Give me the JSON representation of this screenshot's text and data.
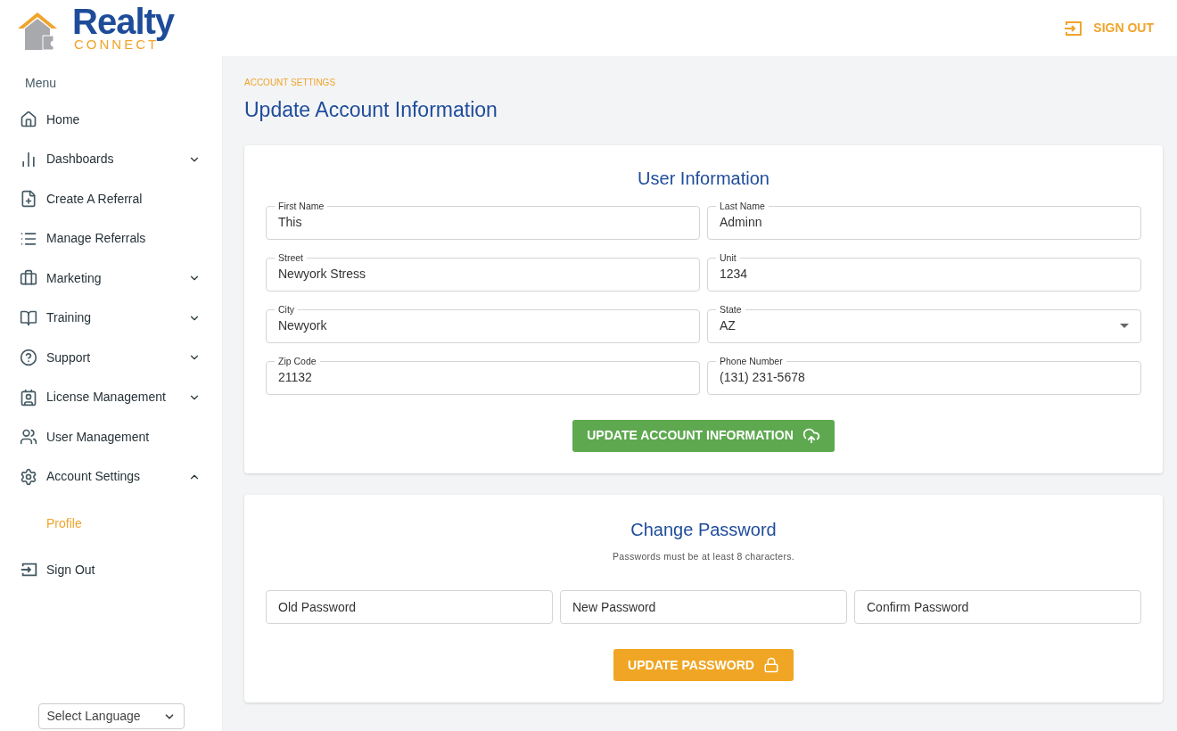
{
  "logo": {
    "word": "Realty",
    "tagline": "CONNECT"
  },
  "header": {
    "sign_out": "SIGN OUT"
  },
  "sidebar": {
    "heading": "Menu",
    "items": [
      {
        "label": "Home",
        "kind": "link"
      },
      {
        "label": "Dashboards",
        "kind": "group",
        "expanded": false
      },
      {
        "label": "Create A Referral",
        "kind": "link"
      },
      {
        "label": "Manage Referrals",
        "kind": "link"
      },
      {
        "label": "Marketing",
        "kind": "group",
        "expanded": false
      },
      {
        "label": "Training",
        "kind": "group",
        "expanded": false
      },
      {
        "label": "Support",
        "kind": "group",
        "expanded": false
      },
      {
        "label": "License Management",
        "kind": "group",
        "expanded": false
      },
      {
        "label": "User Management",
        "kind": "link"
      },
      {
        "label": "Account Settings",
        "kind": "group",
        "expanded": true,
        "children": [
          {
            "label": "Profile",
            "selected": true
          }
        ]
      },
      {
        "label": "Sign Out",
        "kind": "link"
      }
    ],
    "language": "Select Language"
  },
  "breadcrumb": "ACCOUNT SETTINGS",
  "page_title": "Update Account Information",
  "user_information": {
    "title": "User Information",
    "fields": [
      {
        "label": "First Name",
        "value": "This",
        "kind": "text"
      },
      {
        "label": "Last Name",
        "value": "Adminn",
        "kind": "text"
      },
      {
        "label": "Street",
        "value": "Newyork Stress",
        "kind": "text"
      },
      {
        "label": "Unit",
        "value": "1234",
        "kind": "text"
      },
      {
        "label": "City",
        "value": "Newyork",
        "kind": "text"
      },
      {
        "label": "State",
        "value": "AZ",
        "kind": "select"
      },
      {
        "label": "Zip Code",
        "value": "21132",
        "kind": "text"
      },
      {
        "label": "Phone Number",
        "value": "(131) 231-5678",
        "kind": "text"
      }
    ],
    "button": "UPDATE ACCOUNT INFORMATION"
  },
  "change_password": {
    "title": "Change Password",
    "hint": "Passwords must be at least 8 characters.",
    "fields": [
      {
        "placeholder": "Old Password"
      },
      {
        "placeholder": "New Password"
      },
      {
        "placeholder": "Confirm Password"
      }
    ],
    "button": "UPDATE PASSWORD"
  }
}
